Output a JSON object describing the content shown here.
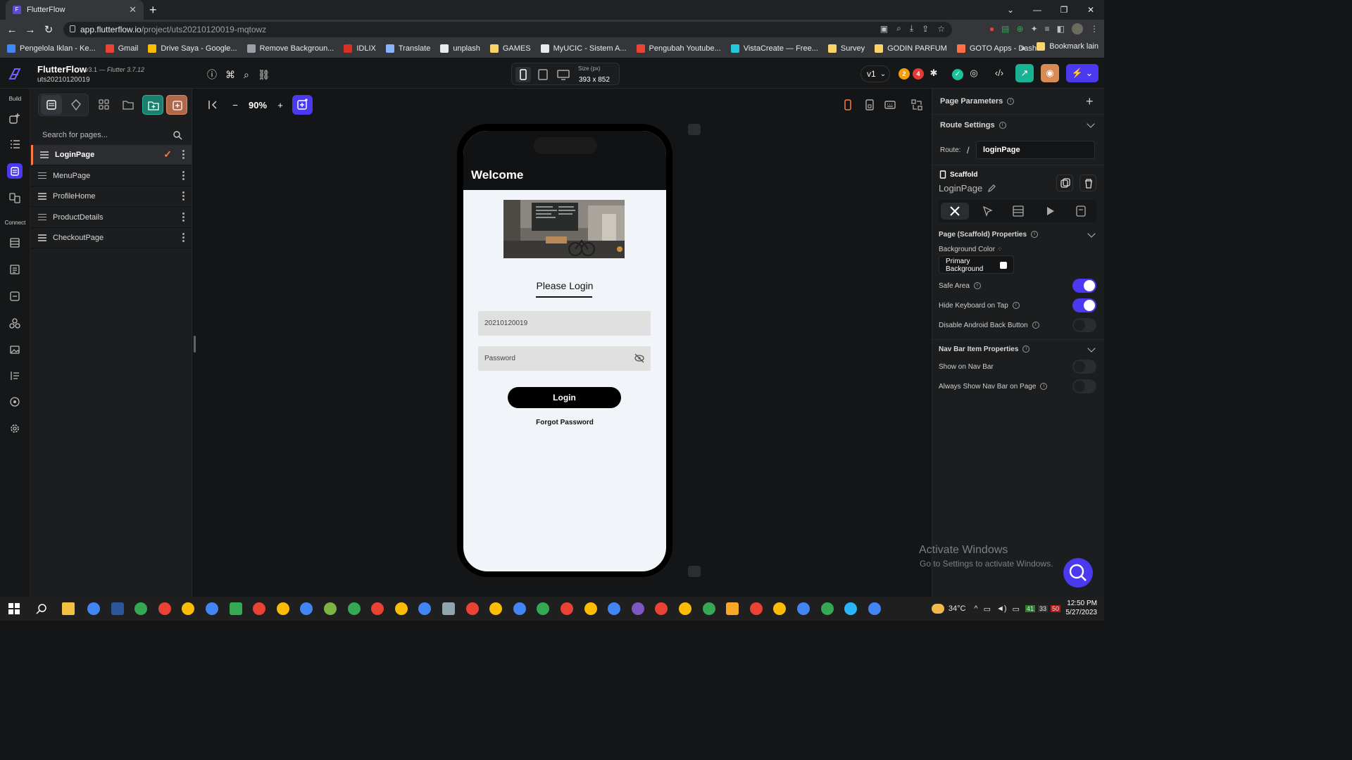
{
  "browser": {
    "tab_title": "FlutterFlow",
    "url_host": "app.flutterflow.io",
    "url_path": "/project/uts20210120019-mqtowz",
    "bookmarks": [
      {
        "label": "Pengelola Iklan - Ke...",
        "color": "#4285f4"
      },
      {
        "label": "Gmail",
        "color": "#ea4335"
      },
      {
        "label": "Drive Saya - Google...",
        "color": "#fbbc04"
      },
      {
        "label": "Remove Backgroun...",
        "color": "#9aa0a6"
      },
      {
        "label": "IDLIX",
        "color": "#d93025"
      },
      {
        "label": "Translate",
        "color": "#8ab4f8"
      },
      {
        "label": "unplash",
        "color": "#e8eaed"
      },
      {
        "label": "GAMES",
        "color": "#f9d36b"
      },
      {
        "label": "MyUCIC - Sistem A...",
        "color": "#e8eaed"
      },
      {
        "label": "Pengubah Youtube...",
        "color": "#ea4335"
      },
      {
        "label": "VistaCreate — Free...",
        "color": "#26c6da"
      },
      {
        "label": "Survey",
        "color": "#f9d36b"
      },
      {
        "label": "GODIN PARFUM",
        "color": "#f9d36b"
      },
      {
        "label": "GOTO Apps - Dash...",
        "color": "#ff7043"
      }
    ],
    "bookmark_more": "»",
    "bookmark_other": "Bookmark lain"
  },
  "app": {
    "title": "FlutterFlow",
    "version": "v3.1 —",
    "flutter_version": "Flutter 3.7.12",
    "project_id": "uts20210120019",
    "size_label": "Size (px)",
    "size_value": "393 x 852",
    "app_version": "v1",
    "badge_warnings": "2",
    "badge_errors": "4"
  },
  "rail": {
    "build_label": "Build",
    "connect_label": "Connect"
  },
  "pages_panel": {
    "search_placeholder": "Search for pages...",
    "pages": [
      {
        "name": "LoginPage"
      },
      {
        "name": "MenuPage"
      },
      {
        "name": "ProfileHome"
      },
      {
        "name": "ProductDetails"
      },
      {
        "name": "CheckoutPage"
      }
    ]
  },
  "canvas": {
    "zoom": "90%",
    "zoom_minus": "−",
    "zoom_plus": "+"
  },
  "phone": {
    "header_title": "Welcome",
    "heading": "Please Login",
    "username_value": "20210120019",
    "password_placeholder": "Password",
    "login_button": "Login",
    "forgot_password": "Forgot Password"
  },
  "props": {
    "page_parameters": "Page Parameters",
    "route_settings": "Route Settings",
    "route_label": "Route:",
    "route_slash": "/",
    "route_value": "loginPage",
    "widget_type": "Scaffold",
    "widget_name": "LoginPage",
    "page_props_title": "Page (Scaffold) Properties",
    "bg_color_label": "Background Color",
    "bg_color_value": "Primary Background",
    "safe_area": "Safe Area",
    "hide_keyboard": "Hide Keyboard on Tap",
    "disable_back": "Disable Android Back Button",
    "nav_bar_title": "Nav Bar Item Properties",
    "show_nav": "Show on Nav Bar",
    "always_show_nav": "Always Show Nav Bar on Page",
    "toggles": {
      "safe_area": true,
      "hide_keyboard": true,
      "disable_back": false,
      "show_nav": false,
      "always_show_nav": false
    }
  },
  "os": {
    "watermark_title": "Activate Windows",
    "watermark_sub": "Go to Settings to activate Windows.",
    "weather": "34°C",
    "time": "12:50 PM",
    "date": "5/27/2023"
  },
  "colors": {
    "accent": "#4b39ef",
    "active_page_marker": "#ff7a3d"
  }
}
